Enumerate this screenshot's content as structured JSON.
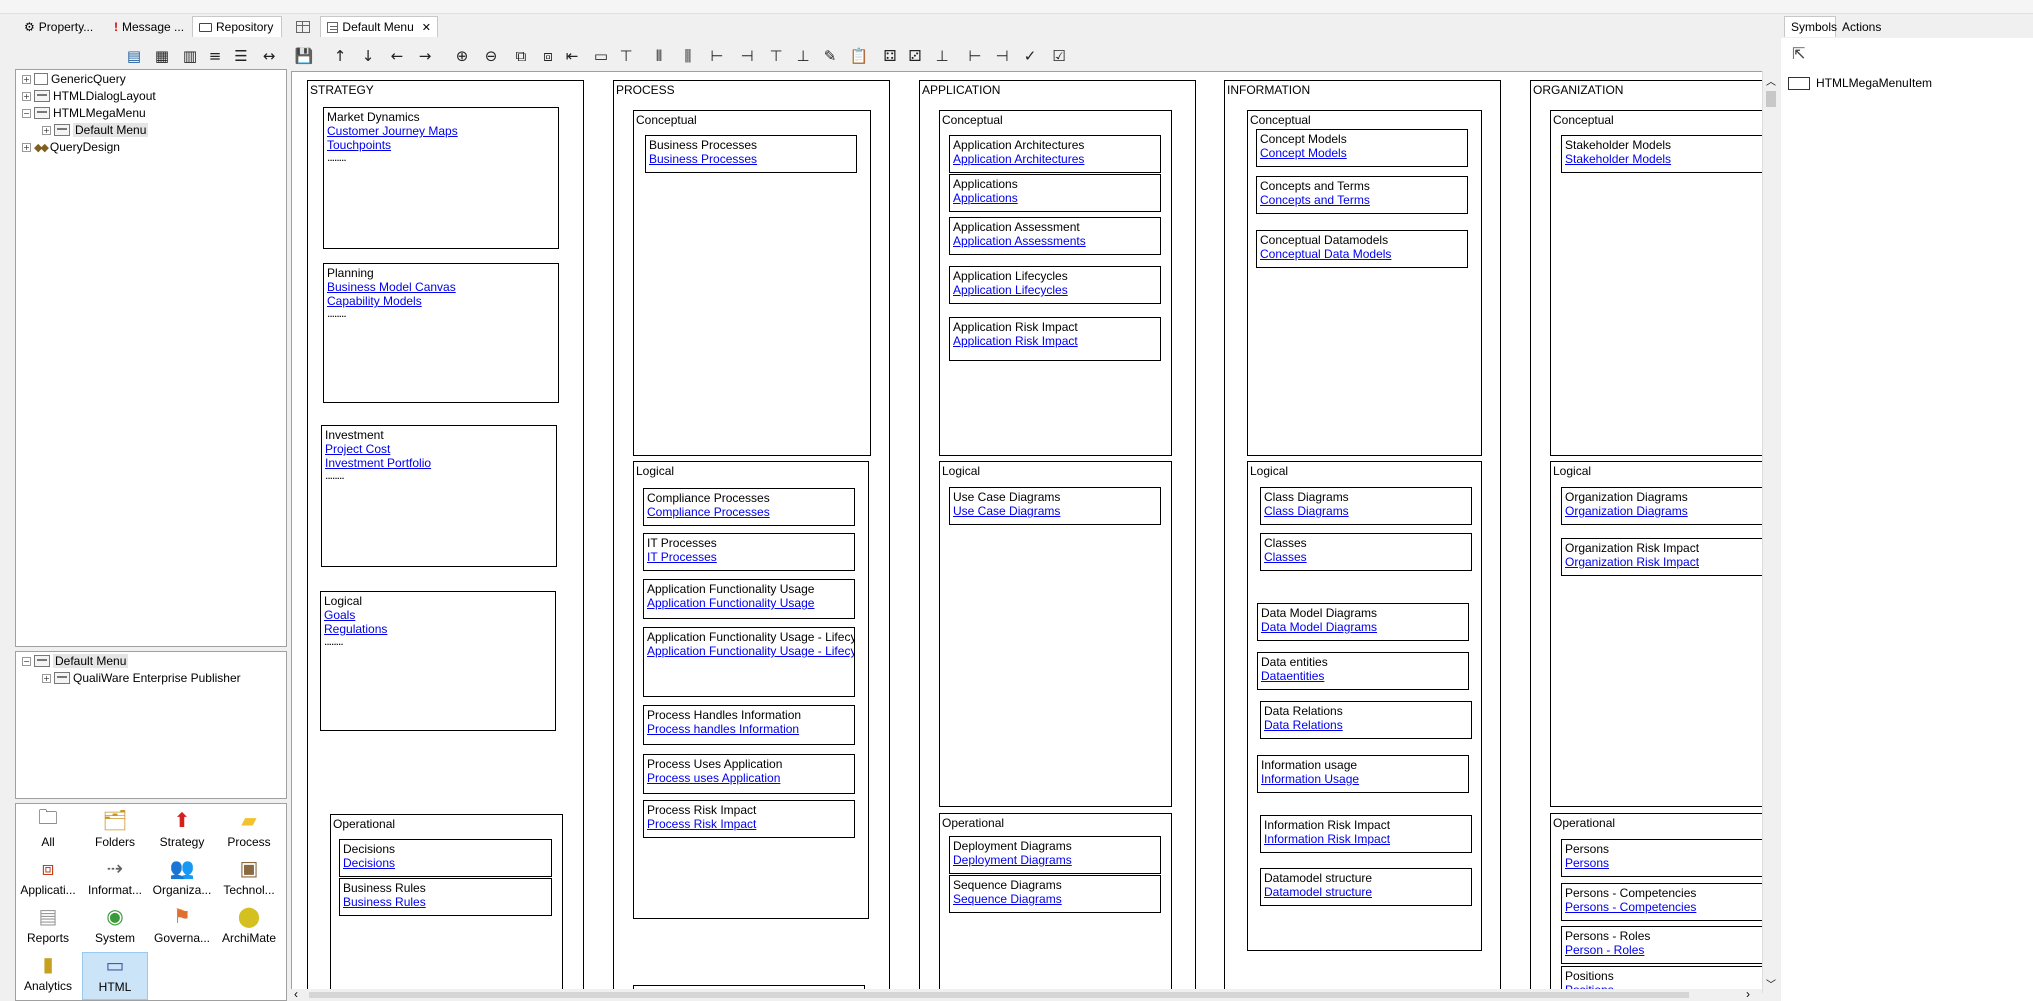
{
  "top_tabs": [
    {
      "label": "Property..."
    },
    {
      "label": "Message ..."
    },
    {
      "label": "Repository"
    },
    {
      "label": "Default Menu"
    }
  ],
  "right_tabs": {
    "symbols": "Symbols",
    "actions": "Actions"
  },
  "repo_tree": [
    "GenericQuery",
    "HTMLDialogLayout",
    "HTMLMegaMenu",
    "Default Menu",
    "QueryDesign"
  ],
  "menu_tree": [
    "Default Menu",
    "QualiWare Enterprise Publisher"
  ],
  "palette": [
    {
      "label": "All",
      "icon": "folder-open-icon",
      "color": "#222222"
    },
    {
      "label": "Folders",
      "icon": "folders-icon",
      "color": "#c9962a"
    },
    {
      "label": "Strategy",
      "icon": "strategy-arrow-icon",
      "color": "#d62020"
    },
    {
      "label": "Process",
      "icon": "process-chevron-icon",
      "color": "#f2c230"
    },
    {
      "label": "Applicati...",
      "icon": "application-icon",
      "color": "#c04020"
    },
    {
      "label": "Informat...",
      "icon": "information-icon",
      "color": "#606060"
    },
    {
      "label": "Organiza...",
      "icon": "organization-icon",
      "color": "#d08a30"
    },
    {
      "label": "Technol...",
      "icon": "technology-icon",
      "color": "#8a6a40"
    },
    {
      "label": "Reports",
      "icon": "reports-icon",
      "color": "#9a9a9a"
    },
    {
      "label": "System",
      "icon": "system-icon",
      "color": "#3a9a3a"
    },
    {
      "label": "Governa...",
      "icon": "governance-icon",
      "color": "#e07030"
    },
    {
      "label": "ArchiMate",
      "icon": "archimate-icon",
      "color": "#d4c020"
    },
    {
      "label": "Analytics",
      "icon": "analytics-icon",
      "color": "#c8a020"
    },
    {
      "label": "HTML",
      "icon": "html-icon",
      "color": "#4060a0"
    }
  ],
  "symbols": [
    "HTMLMegaMenuItem"
  ],
  "accent": "#0000ee",
  "canvas": {
    "columns": [
      {
        "title": "STRATEGY"
      },
      {
        "title": "PROCESS",
        "sections": [
          "Conceptual",
          "Logical"
        ]
      },
      {
        "title": "APPLICATION",
        "sections": [
          "Conceptual",
          "Logical",
          "Operational"
        ]
      },
      {
        "title": "INFORMATION",
        "sections": [
          "Conceptual",
          "Logical"
        ]
      },
      {
        "title": "ORGANIZATION",
        "sections": [
          "Conceptual",
          "Logical",
          "Operational"
        ]
      }
    ],
    "strategy_cards": [
      {
        "title": "Market Dynamics",
        "links": [
          "Customer Journey Maps",
          "Touchpoints"
        ],
        "more": "........"
      },
      {
        "title": "Planning",
        "links": [
          "Business Model Canvas",
          "Capability Models"
        ],
        "more": "........"
      },
      {
        "title": "Investment",
        "links": [
          "Project Cost",
          "Investment Portfolio"
        ],
        "more": "........"
      },
      {
        "title": "Logical",
        "links": [
          "Goals",
          "Regulations"
        ],
        "more": "........"
      }
    ],
    "strategy_operational": {
      "title": "Operational",
      "cards": [
        {
          "title": "Decisions",
          "link": "Decisions"
        },
        {
          "title": "Business Rules",
          "link": "Business Rules"
        }
      ]
    },
    "process_conceptual": [
      {
        "title": "Business Processes",
        "link": "Business Processes"
      }
    ],
    "process_logical": [
      {
        "title": "Compliance Processes",
        "link": "Compliance Processes"
      },
      {
        "title": "IT Processes",
        "link": "IT Processes"
      },
      {
        "title": "Application Functionality Usage",
        "link": "Application Functionality Usage"
      },
      {
        "title": "Application Functionality Usage - Lifecycles",
        "link": "Application Functionality Usage - Lifecycles"
      },
      {
        "title": "Process Handles Information",
        "link": "Process handles Information"
      },
      {
        "title": "Process Uses Application",
        "link": "Process uses Application"
      },
      {
        "title": "Process Risk Impact",
        "link": "Process Risk Impact"
      }
    ],
    "application_conceptual": [
      {
        "title": "Application Architectures",
        "link": "Application Architectures"
      },
      {
        "title": "Applications",
        "link": "Applications"
      },
      {
        "title": "Application Assessment",
        "link": "Application Assessments"
      },
      {
        "title": "Application Lifecycles",
        "link": "Application Lifecycles"
      },
      {
        "title": "Application Risk Impact",
        "link": "Application Risk Impact"
      }
    ],
    "application_logical": [
      {
        "title": "Use Case Diagrams",
        "link": "Use Case Diagrams"
      }
    ],
    "application_operational": [
      {
        "title": "Deployment Diagrams",
        "link": "Deployment Diagrams"
      },
      {
        "title": "Sequence Diagrams",
        "link": "Sequence Diagrams"
      }
    ],
    "information_conceptual": [
      {
        "title": "Concept Models",
        "link": "Concept Models"
      },
      {
        "title": "Concepts and Terms",
        "link": "Concepts and Terms"
      },
      {
        "title": "Conceptual Datamodels",
        "link": "Conceptual Data Models"
      }
    ],
    "information_logical": [
      {
        "title": "Class Diagrams",
        "link": "Class Diagrams"
      },
      {
        "title": "Classes",
        "link": "Classes"
      },
      {
        "title": "Data Model Diagrams",
        "link": "Data Model Diagrams"
      },
      {
        "title": "Data entities",
        "link": "Dataentities"
      },
      {
        "title": "Data Relations",
        "link": "Data Relations"
      },
      {
        "title": "Information usage",
        "link": "Information Usage"
      },
      {
        "title": "Information Risk Impact",
        "link": "Information Risk Impact"
      },
      {
        "title": "Datamodel structure",
        "link": "Datamodel structure"
      }
    ],
    "organization_conceptual": [
      {
        "title": "Stakeholder Models",
        "link": "Stakeholder Models"
      }
    ],
    "organization_logical": [
      {
        "title": "Organization Diagrams",
        "link": "Organization Diagrams"
      },
      {
        "title": "Organization Risk Impact",
        "link": "Organization Risk Impact"
      }
    ],
    "organization_operational": [
      {
        "title": "Persons",
        "link": "Persons"
      },
      {
        "title": "Persons - Competencies",
        "link": "Persons - Competencies"
      },
      {
        "title": "Persons - Roles",
        "link": "Person - Roles"
      },
      {
        "title": "Positions",
        "link": "Positions"
      }
    ]
  }
}
